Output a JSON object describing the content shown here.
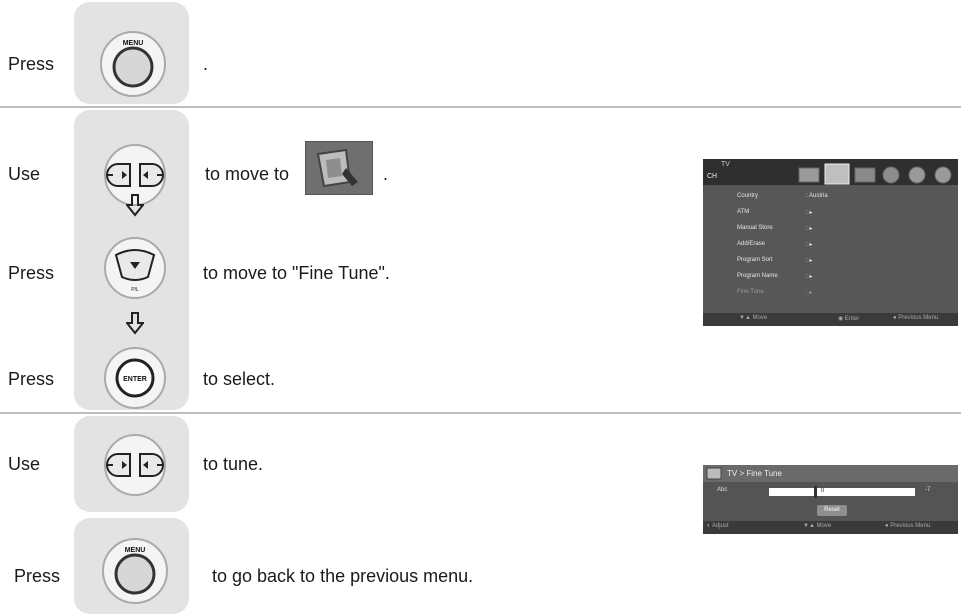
{
  "steps": [
    {
      "verb": "Press",
      "text": "."
    },
    {
      "verb": "Use",
      "text_before": "to move to",
      "text_after": "."
    },
    {
      "verb": "Press",
      "text": "to move to \"Fine Tune\"."
    },
    {
      "verb": "Press",
      "text": "to select."
    },
    {
      "verb": "Use",
      "text": "to tune."
    },
    {
      "verb": "Press",
      "text": "to go back to the previous menu."
    }
  ],
  "buttons": {
    "menu_label": "MENU",
    "enter_label": "ENTER"
  },
  "icons": {
    "arrow1": "down-arrow-icon",
    "arrow2": "down-arrow-icon"
  },
  "tv_menu": {
    "header": "TV",
    "section": "CH",
    "items": [
      {
        "label": "Country",
        "value": ": Austria"
      },
      {
        "label": "ATM",
        "value": ": ▸"
      },
      {
        "label": "Manual Store",
        "value": ": ▸"
      },
      {
        "label": "Add/Erase",
        "value": ": ▸"
      },
      {
        "label": "Program Sort",
        "value": ": ▸"
      },
      {
        "label": "Program Name",
        "value": ": ▸"
      },
      {
        "label": "Fine Tune",
        "value": ": ▸"
      }
    ],
    "footer": {
      "move": "▼▲ Move",
      "enter": "◉ Enter",
      "prev": "● Previous Menu"
    }
  },
  "fine_tune": {
    "title": "TV > Fine Tune",
    "row_label": "Abc",
    "value": "0",
    "right_value": "-7",
    "reset_label": "Reset",
    "footer": {
      "adjust": "◐ Adjust",
      "move": "▼▲ Move",
      "prev": "● Previous Menu"
    }
  },
  "colors": {
    "panel": "#e3e3e3",
    "divider": "#bdbdbd",
    "tv_bg": "#4a4a4a"
  }
}
